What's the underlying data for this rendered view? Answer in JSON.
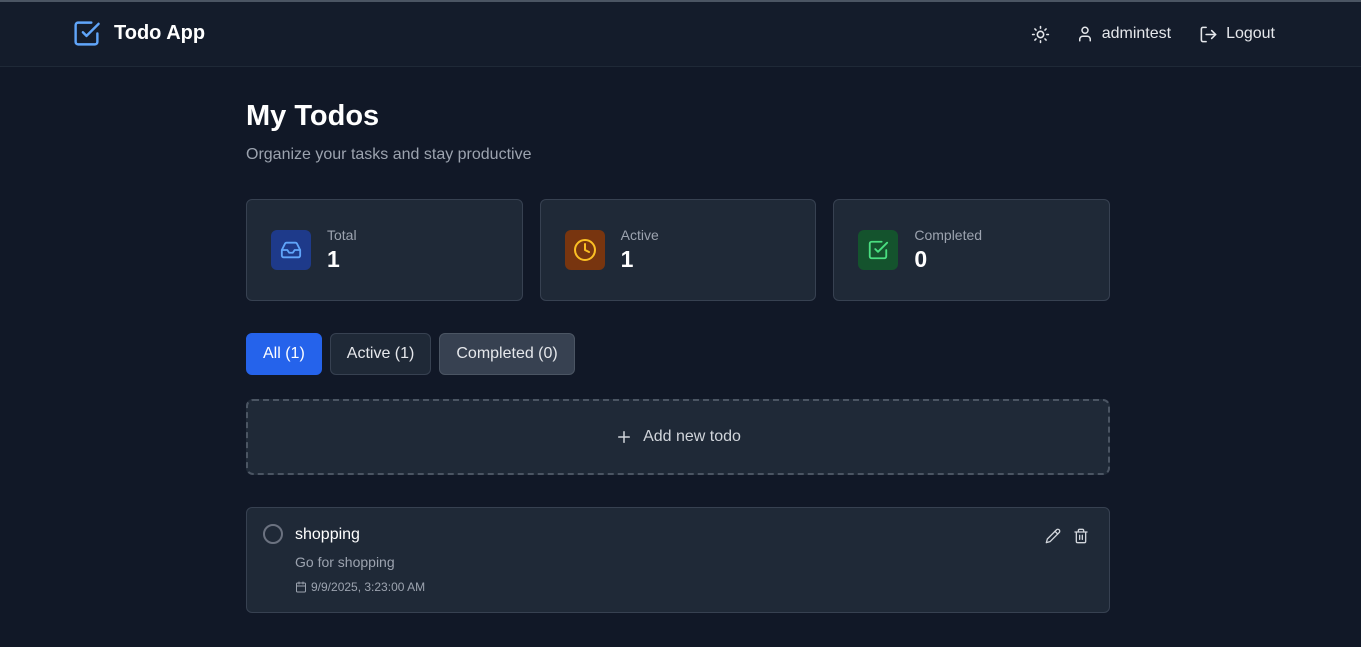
{
  "app": {
    "title": "Todo App"
  },
  "header": {
    "username": "admintest",
    "logout_label": "Logout"
  },
  "page": {
    "title": "My Todos",
    "subtitle": "Organize your tasks and stay productive"
  },
  "stats": [
    {
      "label": "Total",
      "value": "1",
      "icon": "inbox-icon",
      "color": "#60a5fa",
      "bg": "#1e3a8a"
    },
    {
      "label": "Active",
      "value": "1",
      "icon": "clock-icon",
      "color": "#fbbf24",
      "bg": "#78350f"
    },
    {
      "label": "Completed",
      "value": "0",
      "icon": "check-square-icon",
      "color": "#4ade80",
      "bg": "#14532d"
    }
  ],
  "filters": [
    {
      "label": "All (1)",
      "state": "selected"
    },
    {
      "label": "Active (1)",
      "state": "default"
    },
    {
      "label": "Completed (0)",
      "state": "hover"
    }
  ],
  "add_new": {
    "label": "Add new todo"
  },
  "todos": [
    {
      "title": "shopping",
      "description": "Go for shopping",
      "date": "9/9/2025, 3:23:00 AM",
      "completed": false
    }
  ],
  "colors": {
    "accent": "#2563eb",
    "background": "#111827",
    "card": "#1f2937",
    "brand_icon": "#60a5fa"
  }
}
